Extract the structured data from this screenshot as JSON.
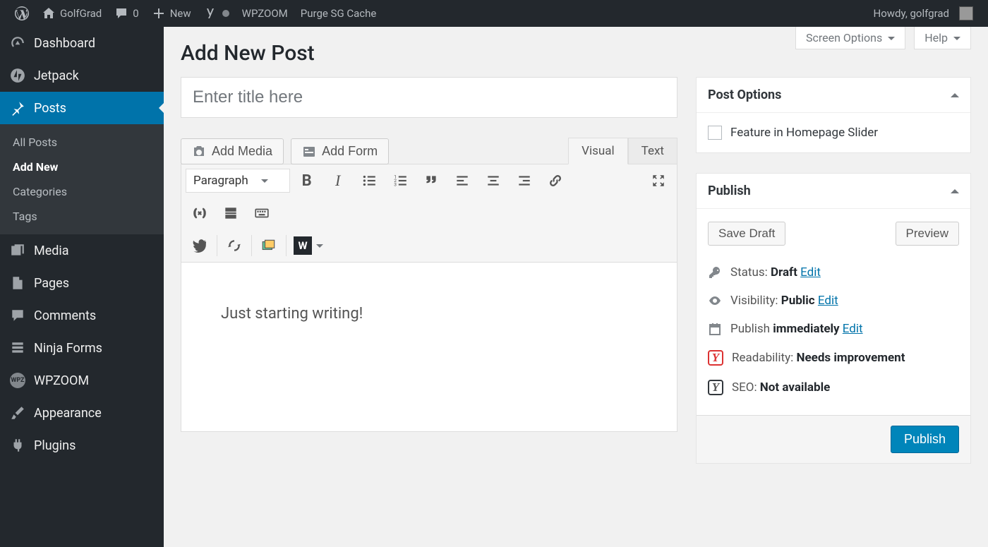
{
  "adminbar": {
    "site_name": "GolfGrad",
    "comments": "0",
    "new_label": "New",
    "wpzoom": "WPZOOM",
    "purge": "Purge SG Cache",
    "howdy": "Howdy, golfgrad"
  },
  "sidebar": {
    "dashboard": "Dashboard",
    "jetpack": "Jetpack",
    "posts": "Posts",
    "all_posts": "All Posts",
    "add_new": "Add New",
    "categories": "Categories",
    "tags": "Tags",
    "media": "Media",
    "pages": "Pages",
    "comments": "Comments",
    "ninja": "Ninja Forms",
    "wpzoom": "WPZOOM",
    "wpzoom_badge": "WPZ",
    "appearance": "Appearance",
    "plugins": "Plugins"
  },
  "top_buttons": {
    "screen": "Screen Options",
    "help": "Help"
  },
  "page_title": "Add New Post",
  "title_placeholder": "Enter title here",
  "media_btn": "Add Media",
  "form_btn": "Add Form",
  "tabs": {
    "visual": "Visual",
    "text": "Text"
  },
  "format_select": "Paragraph",
  "wbtn": "W",
  "body_text": "Just starting writing!",
  "post_options": {
    "title": "Post Options",
    "feature": "Feature in Homepage Slider"
  },
  "publish": {
    "title": "Publish",
    "save": "Save Draft",
    "preview": "Preview",
    "status_label": "Status: ",
    "status_value": "Draft",
    "visibility_label": "Visibility: ",
    "visibility_value": "Public",
    "schedule_label": "Publish ",
    "schedule_value": "immediately",
    "edit": "Edit",
    "readability_label": "Readability: ",
    "readability_value": "Needs improvement",
    "seo_label": "SEO: ",
    "seo_value": "Not available",
    "publish_btn": "Publish"
  }
}
